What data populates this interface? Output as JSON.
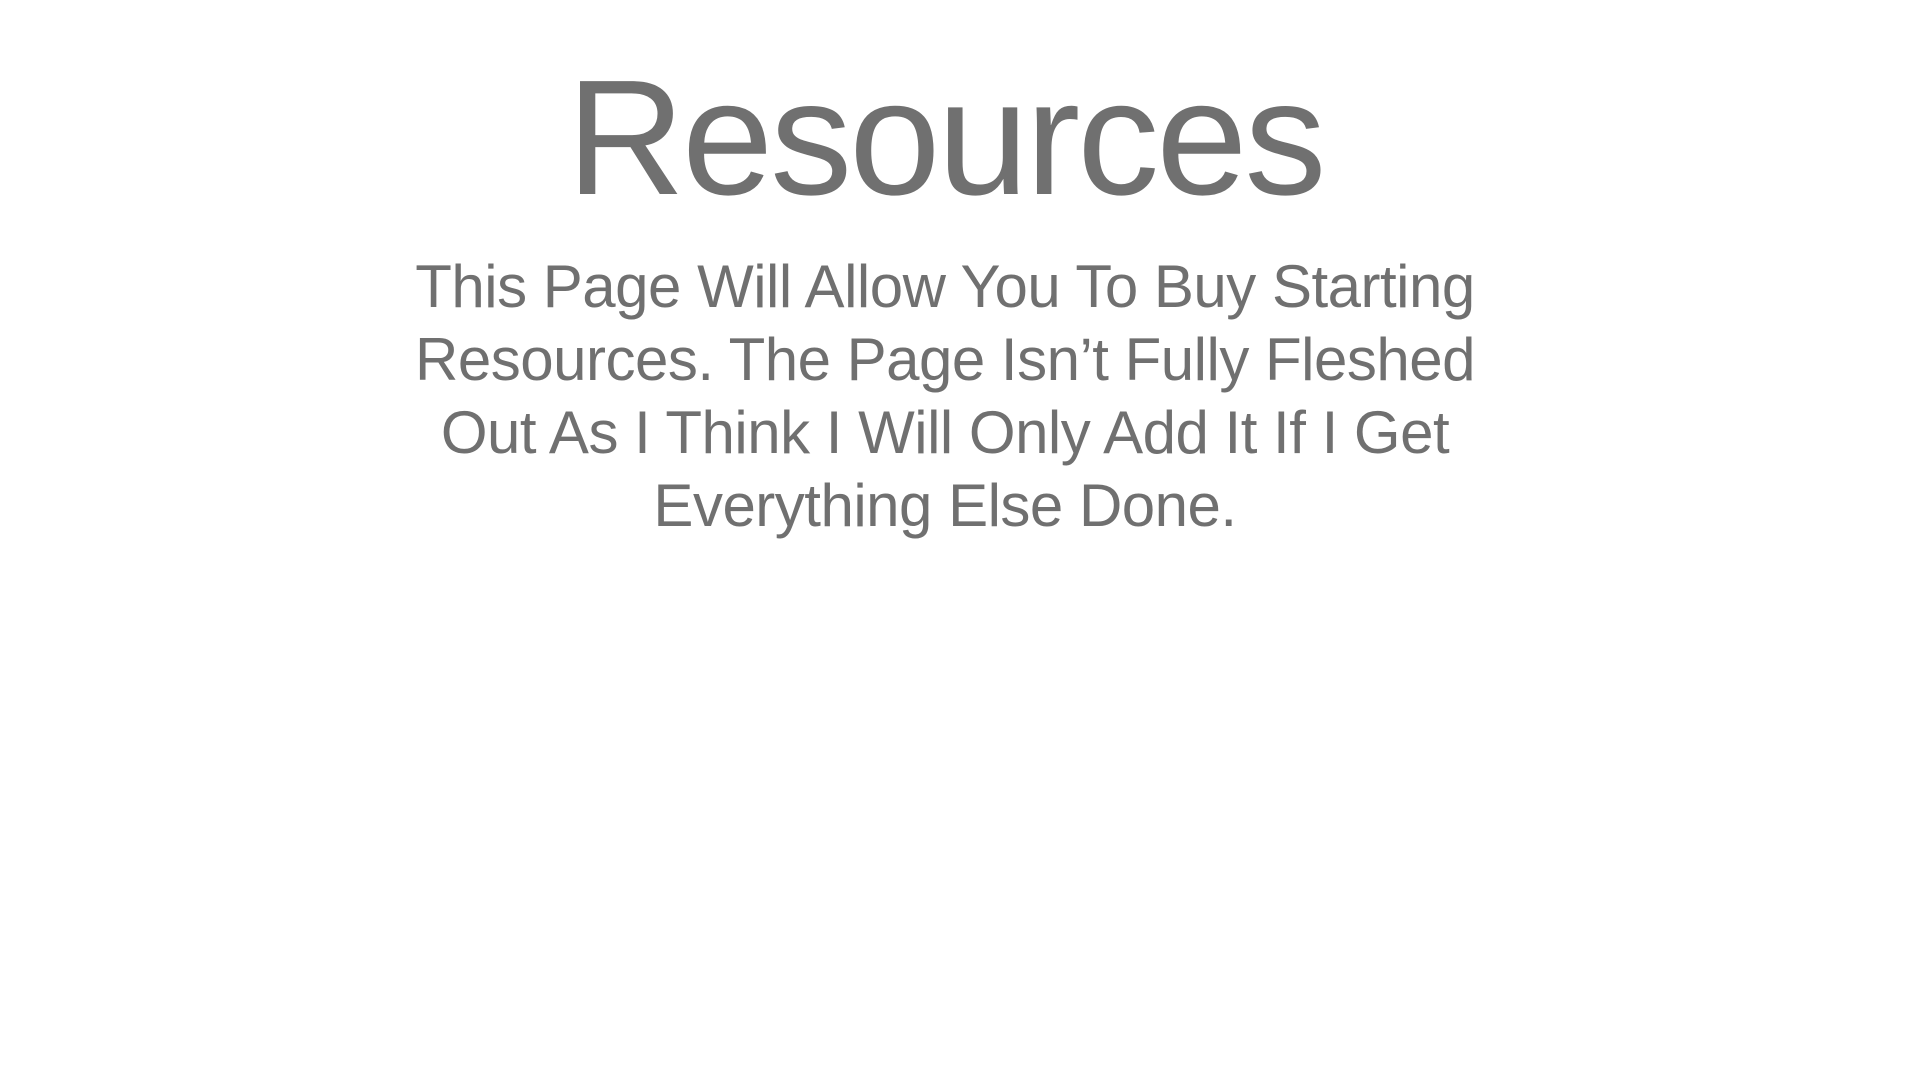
{
  "slide": {
    "title": "Resources",
    "body": "This Page Will Allow You To Buy Starting Resources. The Page Isn’t Fully Fleshed Out As I Think I Will Only Add It If I Get Everything Else Done."
  },
  "colors": {
    "background": "#ffffff",
    "text": "#707070"
  }
}
